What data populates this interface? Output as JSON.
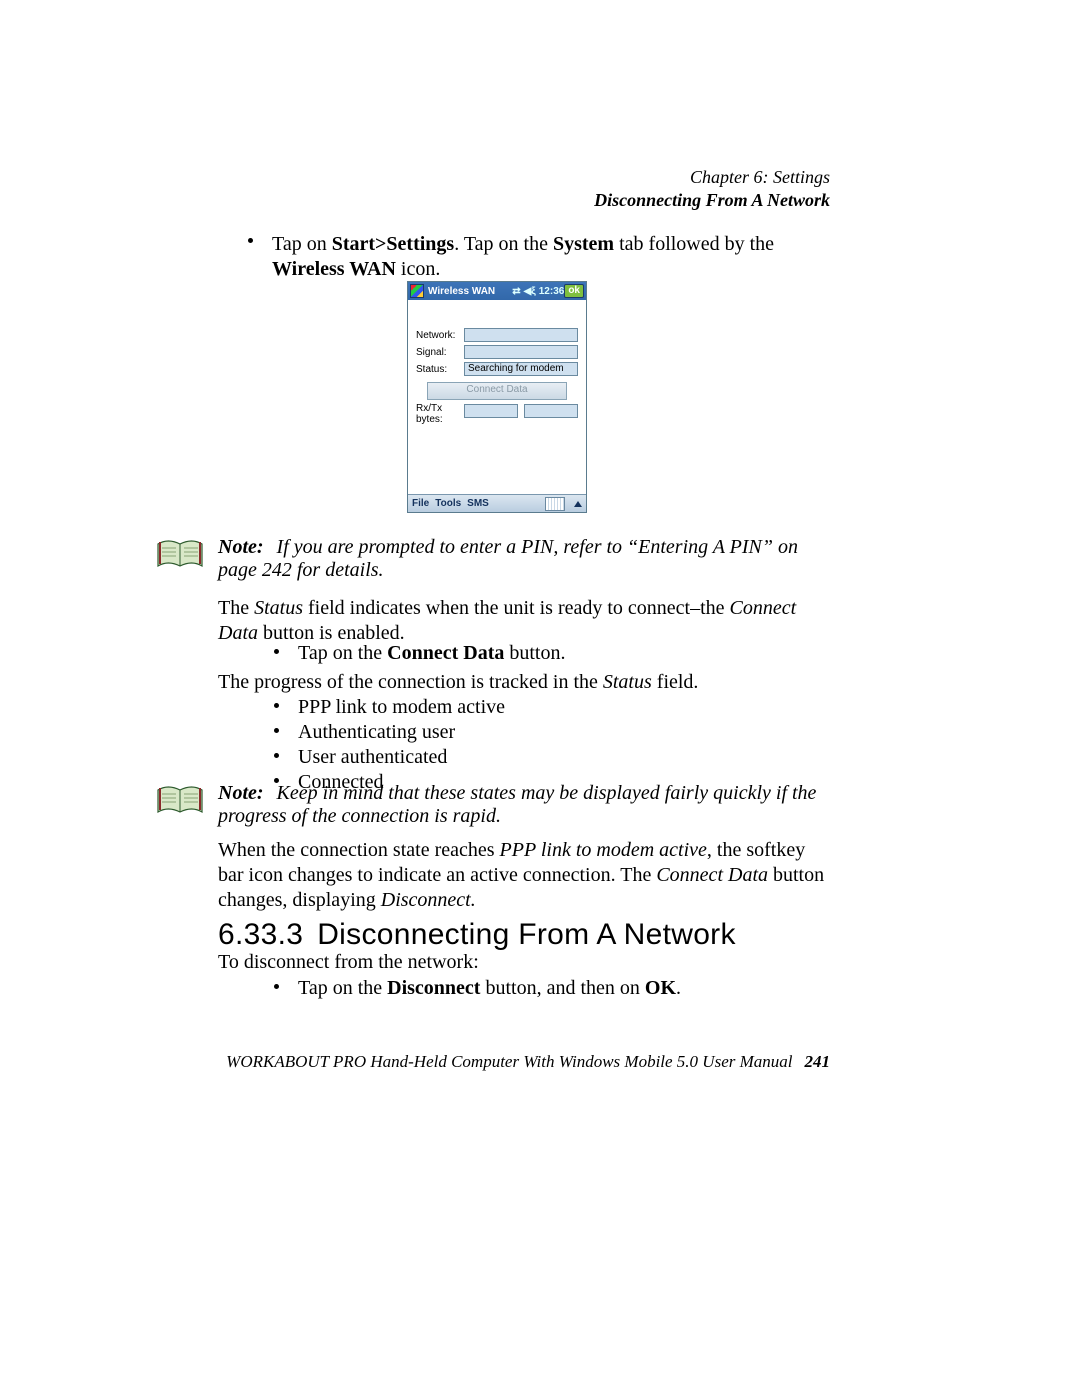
{
  "header": {
    "chapter_line": "Chapter 6:  Settings",
    "section_line": "Disconnecting From A Network"
  },
  "intro": {
    "prefix": "Tap on ",
    "path1": "Start>Settings",
    "mid1": ". Tap on the ",
    "bold2": "System",
    "mid2": " tab followed by the ",
    "bold3": "Wireless WAN",
    "suffix": " icon."
  },
  "pda": {
    "title": "Wireless WAN",
    "time": "12:36",
    "ok": "ok",
    "labels": {
      "network": "Network:",
      "signal": "Signal:",
      "status": "Status:",
      "rxtx_l1": "Rx/Tx",
      "rxtx_l2": "bytes:"
    },
    "values": {
      "network": "",
      "signal": "",
      "status": "Searching for modem",
      "rx": "",
      "tx": ""
    },
    "connect_btn": "Connect Data",
    "menu": {
      "file": "File",
      "tools": "Tools",
      "sms": "SMS"
    }
  },
  "note1": {
    "label": "Note:",
    "text_pre": "If you are prompted to enter a PIN, refer to “Entering A PIN” on page 242 for details."
  },
  "status_para": {
    "t1": "The ",
    "i1": "Status",
    "t2": " field indicates when the unit is ready to connect–the ",
    "i2": "Connect Data",
    "t3": " button is enabled."
  },
  "step_connect": {
    "pre": "Tap on the ",
    "b": "Connect Data",
    "post": " button."
  },
  "progress_line": {
    "t1": "The progress of the connection is tracked in the ",
    "i1": "Status",
    "t2": " field."
  },
  "states": {
    "s1": "PPP link to modem active",
    "s2": "Authenticating user",
    "s3": "User authenticated",
    "s4": "Connected"
  },
  "note2": {
    "label": "Note:",
    "text": "Keep in mind that these states may be displayed fairly quickly if the progress of the connection is rapid."
  },
  "final_para": {
    "t1": "When the connection state reaches ",
    "i1": "PPP link to modem active",
    "t2": ", the softkey bar icon changes to indicate an active connection. The ",
    "i2": "Connect Data",
    "t3": " button changes, displaying ",
    "i3": "Disconnect.",
    "t4": ""
  },
  "section": {
    "num": "6.33.3",
    "title": "Disconnecting From A Network"
  },
  "disconnect_intro": "To disconnect from the network:",
  "disconnect_step": {
    "pre": "Tap on the ",
    "b1": "Disconnect",
    "mid": " button, and then on ",
    "b2": "OK",
    "post": "."
  },
  "footer": {
    "text": "WORKABOUT PRO Hand-Held Computer With Windows Mobile 5.0 User Manual",
    "page": "241"
  }
}
